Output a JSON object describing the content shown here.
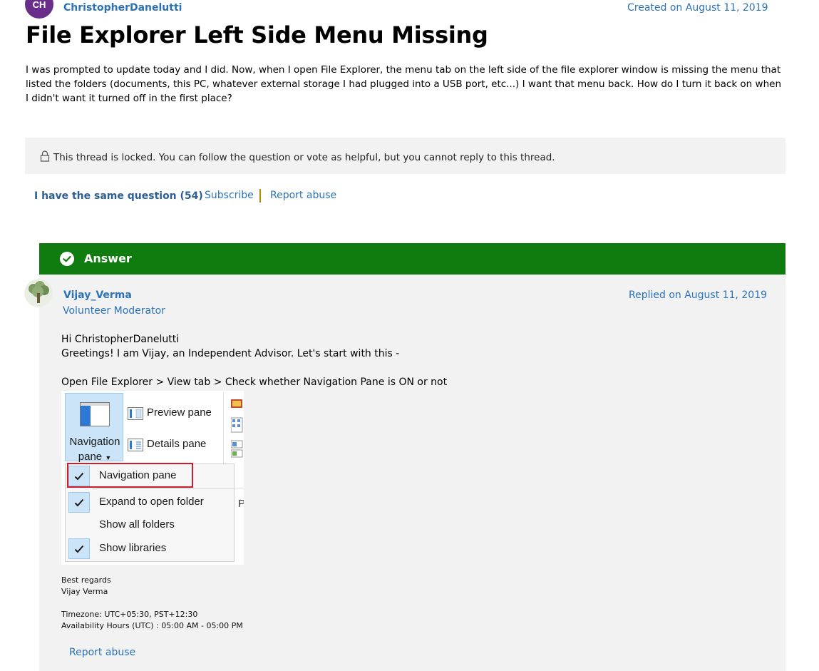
{
  "question": {
    "author_initials": "CH",
    "author_name": "ChristopherDanelutti",
    "created": "Created on August 11, 2019",
    "title": "File Explorer Left Side Menu Missing",
    "body": "I was prompted to update today and I did.  Now, when I open File Explorer, the menu tab on the left side of the file explorer window is missing the menu that listed the folders (documents, this PC, whatever external storage I had plugged into a USB port, etc...)  I want that menu back.  How do I turn it back on when I didn't want it turned off in the first place?"
  },
  "locked": {
    "icon": "lock-icon",
    "text": "This thread is locked. You can follow the question or vote as helpful, but you cannot reply to this thread."
  },
  "actions": {
    "same_question": "I have the same question (54)",
    "subscribe": "Subscribe",
    "report_abuse": "Report abuse"
  },
  "answer": {
    "label": "Answer",
    "header_color": "#107c10",
    "author_name": "Vijay_Verma",
    "author_role": "Volunteer Moderator",
    "replied": "Replied on August 11, 2019",
    "greeting_1": "Hi ChristopherDanelutti",
    "greeting_2": "Greetings! I am Vijay, an Independent Advisor. Let's start with this -",
    "instruction": "Open File Explorer > View tab > Check whether Navigation Pane is ON or not",
    "screenshot": {
      "nav_pane_line1": "Navigation",
      "nav_pane_line2": "pane",
      "preview_pane": "Preview pane",
      "details_pane": "Details pane",
      "partial_letter": "P",
      "menu": [
        {
          "label": "Navigation pane",
          "checked": true,
          "highlighted": true
        },
        {
          "label": "Expand to open folder",
          "checked": true,
          "highlighted": false
        },
        {
          "label": "Show all folders",
          "checked": false,
          "highlighted": false
        },
        {
          "label": "Show libraries",
          "checked": true,
          "highlighted": false
        }
      ],
      "highlight_color": "#d11a2a"
    },
    "signature": {
      "line_1": "Best regards",
      "line_2": "Vijay Verma",
      "line_3": "Timezone: UTC+05:30, PST+12:30",
      "line_4": "Availability Hours (UTC) : 05:00 AM - 05:00 PM"
    },
    "report_abuse": "Report abuse"
  }
}
